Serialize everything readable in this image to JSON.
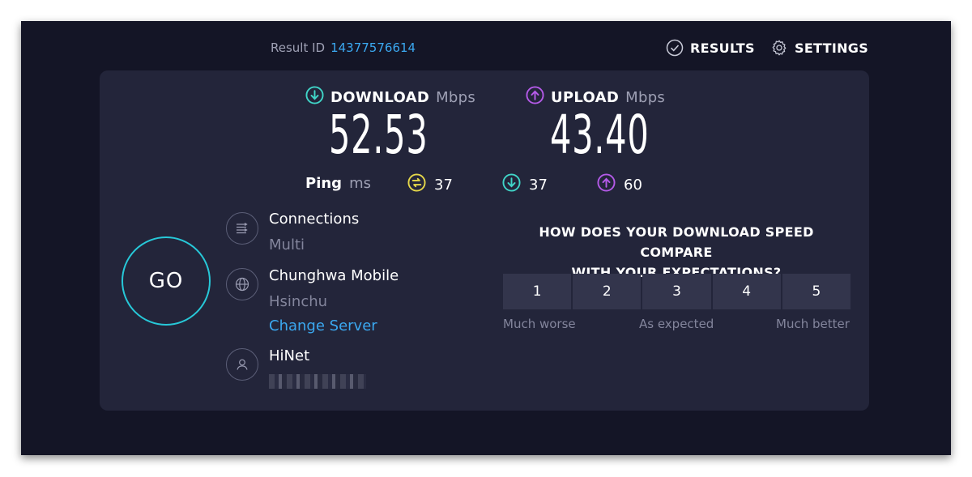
{
  "header": {
    "result_id_label": "Result ID",
    "result_id_value": "14377576614",
    "results_label": "RESULTS",
    "settings_label": "SETTINGS"
  },
  "download": {
    "label": "DOWNLOAD",
    "unit": "Mbps",
    "value": "52.53",
    "color": "#40d5c8"
  },
  "upload": {
    "label": "UPLOAD",
    "unit": "Mbps",
    "value": "43.40",
    "color": "#b45ae8"
  },
  "ping": {
    "label": "Ping",
    "unit": "ms",
    "idle": "37",
    "download": "37",
    "upload": "60",
    "idle_color": "#e6d84a"
  },
  "go_button": {
    "label": "GO",
    "color": "#27c8d8"
  },
  "connections": {
    "title": "Connections",
    "value": "Multi",
    "icon": "connections-icon"
  },
  "server": {
    "title": "Chunghwa Mobile",
    "location": "Hsinchu",
    "change_label": "Change Server",
    "icon": "globe-icon"
  },
  "provider": {
    "title": "HiNet",
    "icon": "user-icon"
  },
  "survey": {
    "question_line1": "HOW DOES YOUR DOWNLOAD SPEED COMPARE",
    "question_line2": "WITH YOUR EXPECTATIONS?",
    "options": [
      "1",
      "2",
      "3",
      "4",
      "5"
    ],
    "low_label": "Much worse",
    "mid_label": "As expected",
    "high_label": "Much better"
  }
}
